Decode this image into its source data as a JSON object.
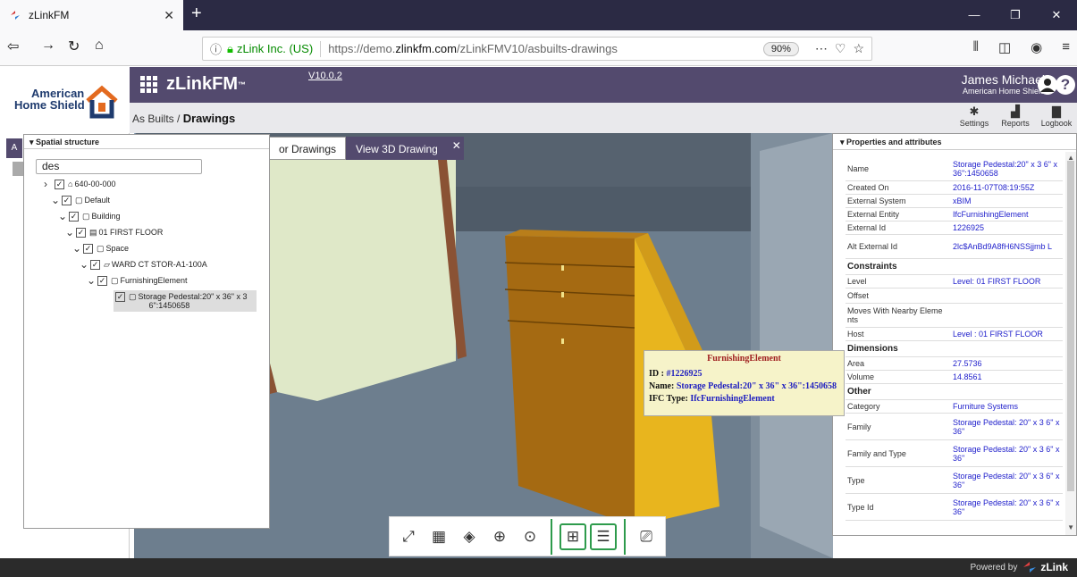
{
  "browser": {
    "tab_title": "zLinkFM",
    "tab_close": "✕",
    "new_tab": "+",
    "url_site": "zLink Inc. (US)",
    "url_prefix": "https://demo.",
    "url_domain": "zlinkfm.com",
    "url_path": "/zLinkFMV10/asbuilts-drawings",
    "zoom": "90%",
    "win_controls": [
      "—",
      "❐",
      "✕"
    ]
  },
  "app": {
    "logo_line1": "American",
    "logo_line2": "Home Shield",
    "brand": "zLinkFM",
    "brand_tm": "™",
    "version": "V10.0.2",
    "user_name": "James Michael",
    "user_org": "American Home Shield",
    "breadcrumb_parent": "As Builts / ",
    "breadcrumb_current": "Drawings",
    "tools": [
      {
        "label": "Settings",
        "icon": "gear-icon"
      },
      {
        "label": "Reports",
        "icon": "chart-icon"
      },
      {
        "label": "Logbook",
        "icon": "book-icon"
      }
    ],
    "strip_tab": "A"
  },
  "drawing_tabs": [
    "or Drawings",
    "View 3D Drawing"
  ],
  "spatial": {
    "title": "Spatial structure",
    "search_value": "des",
    "nodes": [
      {
        "label": "640-00-000",
        "icon": "⌂"
      },
      {
        "label": "Default",
        "icon": "▢"
      },
      {
        "label": "Building",
        "icon": "▢"
      },
      {
        "label": "01 FIRST FLOOR",
        "icon": "▤"
      },
      {
        "label": "Space",
        "icon": "▢"
      },
      {
        "label": "WARD CT STOR-A1-100A",
        "icon": "▱"
      },
      {
        "label": "FurnishingElement",
        "icon": "▢"
      },
      {
        "label_1": "Storage Pedestal:20\" x 36\" x 3",
        "label_2": "6\":1450658",
        "icon": "▢"
      }
    ]
  },
  "properties": {
    "title": "Properties and attributes",
    "rows_top": [
      {
        "k": "Name",
        "v": "Storage Pedestal:20\" x 3 6\" x 36\":1450658"
      },
      {
        "k": "Created On",
        "v": "2016-11-07T08:19:55Z"
      },
      {
        "k": "External System",
        "v": "xBIM"
      },
      {
        "k": "External Entity",
        "v": "IfcFurnishingElement"
      },
      {
        "k": "External Id",
        "v": "1226925"
      },
      {
        "k": "Alt External Id",
        "v": "2lc$AnBd9A8fH6NSSjjmb L"
      }
    ],
    "sec_constraints": "Constraints",
    "rows_constraints": [
      {
        "k": "Level",
        "v": "Level: 01 FIRST FLOOR"
      },
      {
        "k": "Offset",
        "v": ""
      },
      {
        "k": "Moves With Nearby Eleme nts",
        "v": ""
      },
      {
        "k": "Host",
        "v": "Level : 01 FIRST FLOOR"
      }
    ],
    "sec_dimensions": "Dimensions",
    "rows_dimensions": [
      {
        "k": "Area",
        "v": "27.5736"
      },
      {
        "k": "Volume",
        "v": "14.8561"
      }
    ],
    "sec_other": "Other",
    "rows_other": [
      {
        "k": "Category",
        "v": "Furniture Systems"
      },
      {
        "k": "Family",
        "v": "Storage Pedestal: 20\" x 3 6\" x 36\""
      },
      {
        "k": "Family and Type",
        "v": "Storage Pedestal: 20\" x 3 6\" x 36\""
      },
      {
        "k": "Type",
        "v": "Storage Pedestal: 20\" x 3 6\" x 36\""
      },
      {
        "k": "Type Id",
        "v": "Storage Pedestal: 20\" x 3 6\" x 36\""
      }
    ]
  },
  "tooltip": {
    "title": "FurnishingElement",
    "id_label": "ID : ",
    "id_value": "#1226925",
    "name_label": "Name: ",
    "name_value": "Storage Pedestal:20\" x 36\" x 36\":1450658",
    "type_label": "IFC Type: ",
    "type_value": "IfcFurnishingElement"
  },
  "footer": {
    "powered_by": "Powered by",
    "brand": "zLink"
  },
  "colors": {
    "purple": "#534a6e",
    "link_blue": "#2222cc",
    "cabinet": "#c8920c"
  }
}
